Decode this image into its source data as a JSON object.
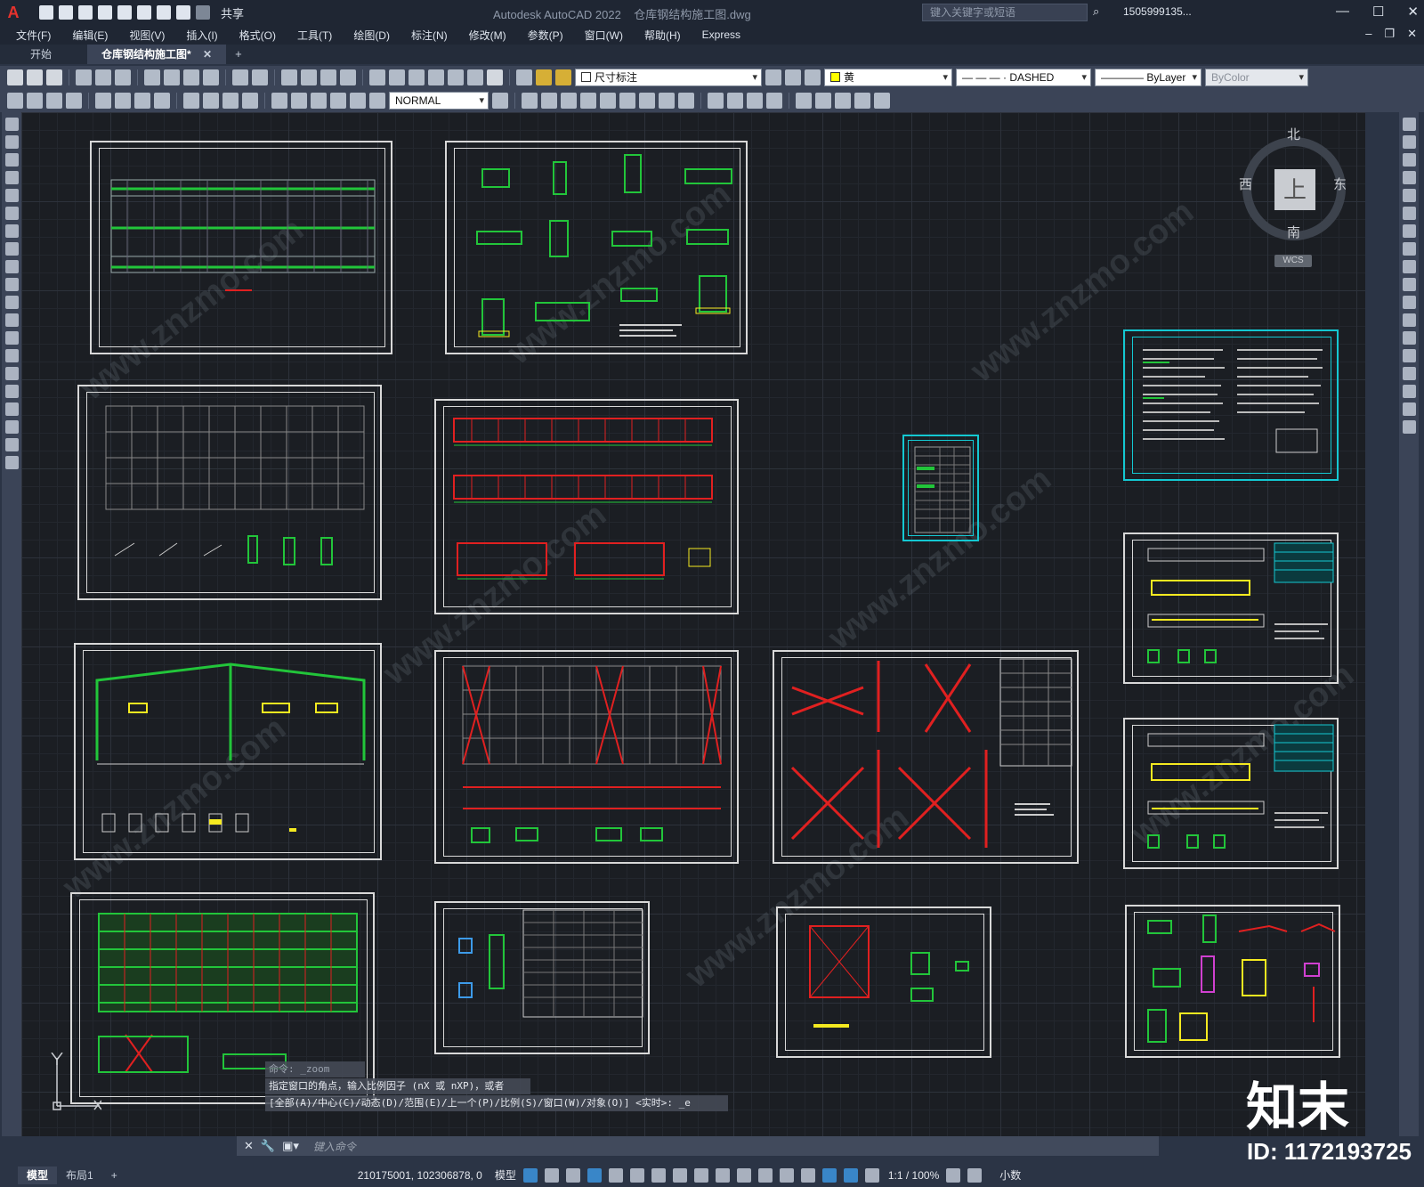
{
  "titlebar": {
    "app_title": "Autodesk AutoCAD 2022",
    "file_title": "仓库钢结构施工图.dwg",
    "share_label": "共享",
    "search_placeholder": "键入关键字或短语",
    "user": "1505999135..."
  },
  "menu": [
    "文件(F)",
    "编辑(E)",
    "视图(V)",
    "插入(I)",
    "格式(O)",
    "工具(T)",
    "绘图(D)",
    "标注(N)",
    "修改(M)",
    "参数(P)",
    "窗口(W)",
    "帮助(H)",
    "Express"
  ],
  "tabs": {
    "start": "开始",
    "active": "仓库钢结构施工图*"
  },
  "toolbar": {
    "layer": "尺寸标注",
    "color": "黄",
    "linetype": "— — — · DASHED",
    "lineweight": "———— ByLayer",
    "plotstyle": "ByColor",
    "textstyle": "NORMAL"
  },
  "viewcube": {
    "north": "北",
    "south": "南",
    "east": "东",
    "west": "西",
    "face": "上",
    "wcs": "WCS"
  },
  "command": {
    "history": [
      "命令: _zoom",
      "指定窗口的角点，输入比例因子 (nX 或 nXP)，或者",
      "[全部(A)/中心(C)/动态(D)/范围(E)/上一个(P)/比例(S)/窗口(W)/对象(O)] <实时>: _e"
    ],
    "placeholder": "键入命令"
  },
  "statusbar": {
    "model_tab": "模型",
    "layout_tab": "布局1",
    "coords": "210175001, 102306878, 0",
    "model_label": "模型",
    "scale": "1:1 / 100%",
    "units": "小数"
  },
  "watermark": {
    "brand": "知末",
    "id": "ID: 1172193725",
    "url": "www.znzmo.com"
  },
  "colors": {
    "canvas": "#1b1e23",
    "sheet_border": "#d8d8d8",
    "sheet_cyan": "#14c8d2",
    "structure_green": "#22c53a",
    "structure_red": "#e02020",
    "structure_yellow": "#f5ea20"
  }
}
